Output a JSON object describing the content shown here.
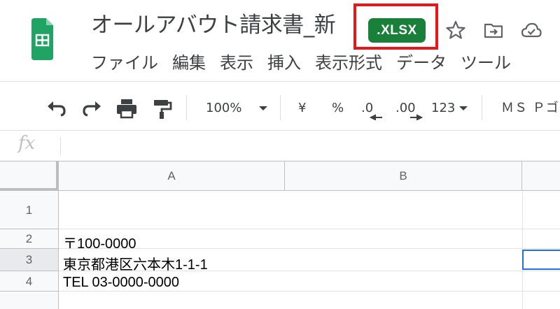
{
  "header": {
    "doc_title": "オールアバウト請求書_新",
    "file_badge": ".XLSX",
    "icons": [
      "star-icon",
      "move-to-folder-icon",
      "cloud-status-icon"
    ]
  },
  "menu": [
    "ファイル",
    "編集",
    "表示",
    "挿入",
    "表示形式",
    "データ",
    "ツール"
  ],
  "toolbar": {
    "zoom": "100%",
    "currency": "¥",
    "percent": "%",
    "decrease_decimal": ".0",
    "increase_decimal": ".00",
    "number_format": "123",
    "font": "ＭＳ Ｐゴ"
  },
  "formula_bar": {
    "fx_label": "fx",
    "value": ""
  },
  "grid": {
    "columns": [
      "A",
      "B"
    ],
    "rows": [
      {
        "num": "1",
        "a": ""
      },
      {
        "num": "2",
        "a": "〒100-0000"
      },
      {
        "num": "3",
        "a": "東京都港区六本木1-1-1"
      },
      {
        "num": "4",
        "a": "TEL 03-0000-0000"
      }
    ]
  },
  "colors": {
    "badge": "#188038",
    "highlight": "#e8151b",
    "selection": "#1a73e8"
  }
}
